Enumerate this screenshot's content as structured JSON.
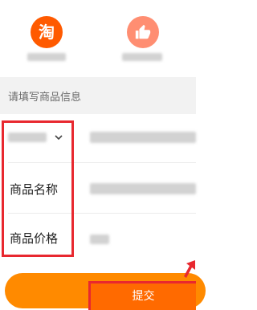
{
  "apps": [
    {
      "glyph": "淘",
      "color": "#ff5a00"
    },
    {
      "icon": "thumbs-up-icon",
      "color": "#ff8e72"
    }
  ],
  "form": {
    "section_title": "请填写商品信息",
    "fields": [
      {
        "label": ""
      },
      {
        "label": "商品名称"
      },
      {
        "label": "商品价格"
      }
    ]
  },
  "submit_label": "提交",
  "colors": {
    "accent_orange": "#ff6a00",
    "highlight_red": "#e8282f"
  }
}
